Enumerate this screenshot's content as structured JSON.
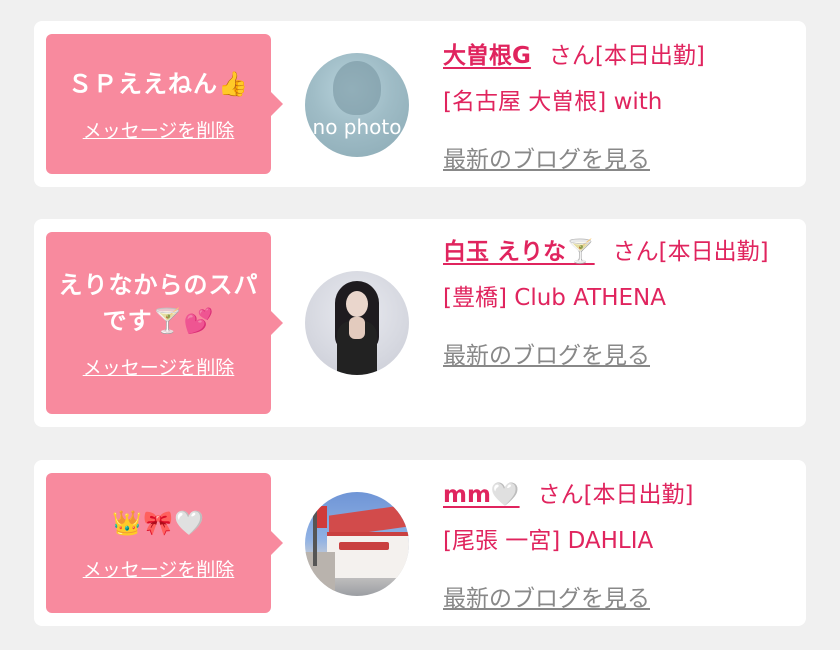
{
  "favorites": [
    {
      "message": "ＳＰええねん👍",
      "delete_label": "メッセージを削除",
      "avatar_text": "no photo",
      "name": "大曽根G",
      "san": "さん",
      "attendance": "[本日出勤]",
      "shop": "[名古屋 大曽根] with",
      "blog_label": "最新のブログを見る"
    },
    {
      "message_line1": "えりなからのスパ",
      "message_line2": "です🍸💕",
      "delete_label": "メッセージを削除",
      "name": "白玉 えりな🍸",
      "san": "さん",
      "attendance": "[本日出勤]",
      "shop": "[豊橋] Club ATHENA",
      "blog_label": "最新のブログを見る"
    },
    {
      "message": "👑🎀🤍",
      "delete_label": "メッセージを削除",
      "name": "mm🤍",
      "san": "さん",
      "attendance": "[本日出勤]",
      "shop": "[尾張 一宮] DAHLIA",
      "blog_label": "最新のブログを見る"
    }
  ],
  "colors": {
    "bubble": "#f88a9e",
    "accent": "#e0245e",
    "link_gray": "#888888",
    "background": "#f0f0f0"
  }
}
